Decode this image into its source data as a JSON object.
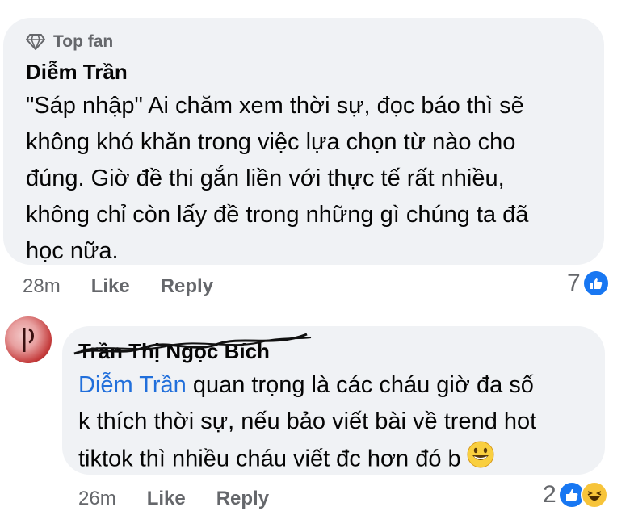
{
  "comment1": {
    "badge": "Top fan",
    "author": "Diễm Trần",
    "text": "\"Sáp nhập\" Ai chăm xem thời sự, đọc báo thì sẽ\nkhông khó khăn trong việc lựa chọn từ nào cho\nđúng. Giờ đề thi gắn liền với thực tế rất nhiều,\nkhông chỉ còn lấy đề trong những gì chúng ta đã\nhọc nữa.",
    "time": "28m",
    "like_label": "Like",
    "reply_label": "Reply",
    "reaction_count": "7"
  },
  "comment2": {
    "author": "Trần Thị Ngọc Bích",
    "mention": "Diễm Trần",
    "text": " quan trọng là các cháu giờ đa số\nk thích thời sự, nếu bảo viết bài về trend hot\ntiktok thì nhiều cháu viết đc hơn đó b",
    "time": "26m",
    "like_label": "Like",
    "reply_label": "Reply",
    "reaction_count": "2"
  },
  "icons": {
    "badge": "diamond-icon",
    "like": "thumbs-up-icon",
    "haha": "laughing-face-icon",
    "emoji": "grinning-face-icon"
  },
  "colors": {
    "bubble": "#f0f2f5",
    "like_blue": "#1877f2",
    "mention": "#216fdb",
    "secondary_text": "#65676b"
  }
}
